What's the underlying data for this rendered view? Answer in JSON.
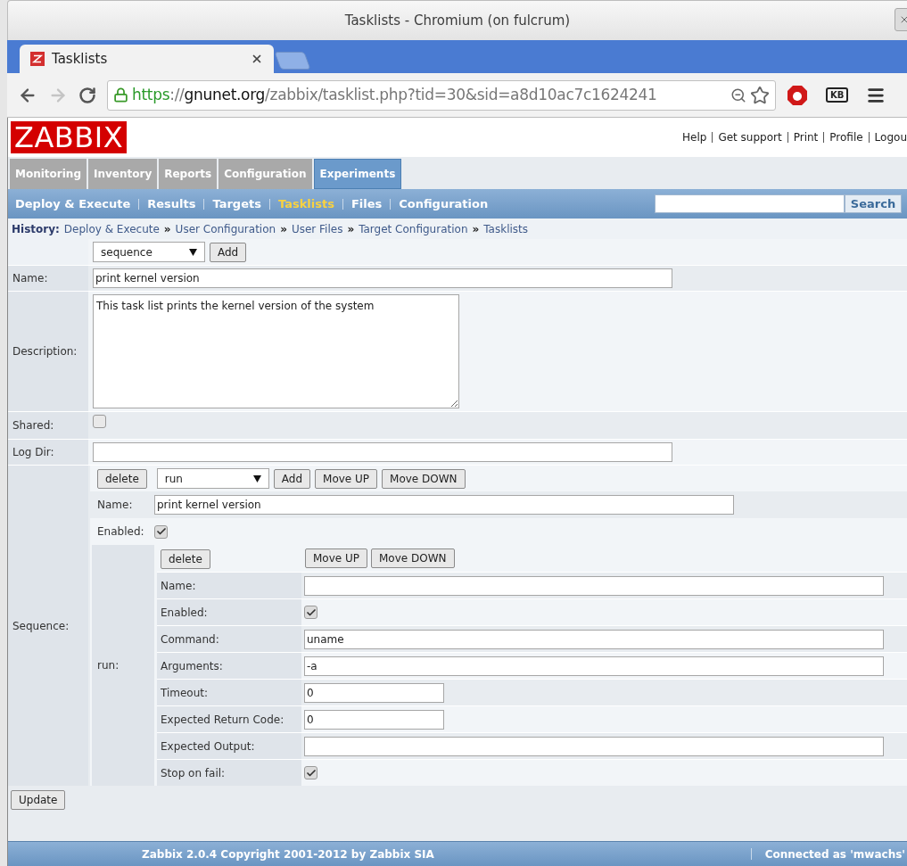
{
  "window": {
    "title": "Tasklists - Chromium (on fulcrum)"
  },
  "browser": {
    "tabs": [
      {
        "label": "Tasklists",
        "selected": true
      }
    ],
    "url": {
      "scheme": "https",
      "separator": "://",
      "host": "gnunet.org",
      "path": "/zabbix/tasklist.php?tid=30&sid=a8d10ac7c1624241"
    },
    "extension_badge": "KB",
    "forward_disabled": true
  },
  "header": {
    "logo": "ZABBIX",
    "links": [
      "Help",
      "Get support",
      "Print",
      "Profile",
      "Logou"
    ]
  },
  "main_menu": [
    {
      "label": "Monitoring",
      "selected": false
    },
    {
      "label": "Inventory",
      "selected": false
    },
    {
      "label": "Reports",
      "selected": false
    },
    {
      "label": "Configuration",
      "selected": false
    },
    {
      "label": "Experiments",
      "selected": true
    }
  ],
  "sub_menu": [
    {
      "label": "Deploy & Execute",
      "selected": false
    },
    {
      "label": "Results",
      "selected": false
    },
    {
      "label": "Targets",
      "selected": false
    },
    {
      "label": "Tasklists",
      "selected": true
    },
    {
      "label": "Files",
      "selected": false
    },
    {
      "label": "Configuration",
      "selected": false
    }
  ],
  "search": {
    "button": "Search"
  },
  "history": {
    "label": "History:",
    "items": [
      "Deploy & Execute",
      "User Configuration",
      "User Files",
      "Target Configuration",
      "Tasklists"
    ],
    "separator": "»"
  },
  "form": {
    "type_select": "sequence",
    "add_button": "Add",
    "fields": [
      {
        "kind": "text",
        "label": "Name:",
        "value": "print kernel version"
      },
      {
        "kind": "textarea",
        "label": "Description:",
        "value": "This task list prints the kernel version of the system"
      },
      {
        "kind": "checkbox",
        "label": "Shared:",
        "checked": false
      },
      {
        "kind": "text",
        "label": "Log Dir:"
      }
    ],
    "sequence": {
      "label": "Sequence:",
      "delete_button": "delete",
      "select": "run",
      "add_button": "Add",
      "move_up": "Move UP",
      "move_down": "Move DOWN",
      "fields": [
        {
          "kind": "text",
          "label": "Name:",
          "value": "print kernel version"
        },
        {
          "kind": "checkbox",
          "label": "Enabled:",
          "checked": true
        }
      ],
      "step": {
        "label": "run:",
        "delete_button": "delete",
        "move_up": "Move UP",
        "move_down": "Move DOWN",
        "fields": [
          {
            "kind": "text",
            "label": "Name:"
          },
          {
            "kind": "checkbox",
            "label": "Enabled:",
            "checked": true
          },
          {
            "kind": "text",
            "label": "Command:",
            "value": "uname"
          },
          {
            "kind": "text",
            "label": "Arguments:",
            "value": "-a"
          },
          {
            "kind": "short",
            "label": "Timeout:",
            "value": "0"
          },
          {
            "kind": "short",
            "label": "Expected Return Code:",
            "value": "0"
          },
          {
            "kind": "text",
            "label": "Expected Output:"
          },
          {
            "kind": "checkbox",
            "label": "Stop on fail:",
            "checked": true
          }
        ]
      }
    },
    "update_button": "Update"
  },
  "footer": {
    "copyright": "Zabbix 2.0.4 Copyright 2001-2012 by Zabbix SIA",
    "user": "Connected as 'mwachs'"
  }
}
